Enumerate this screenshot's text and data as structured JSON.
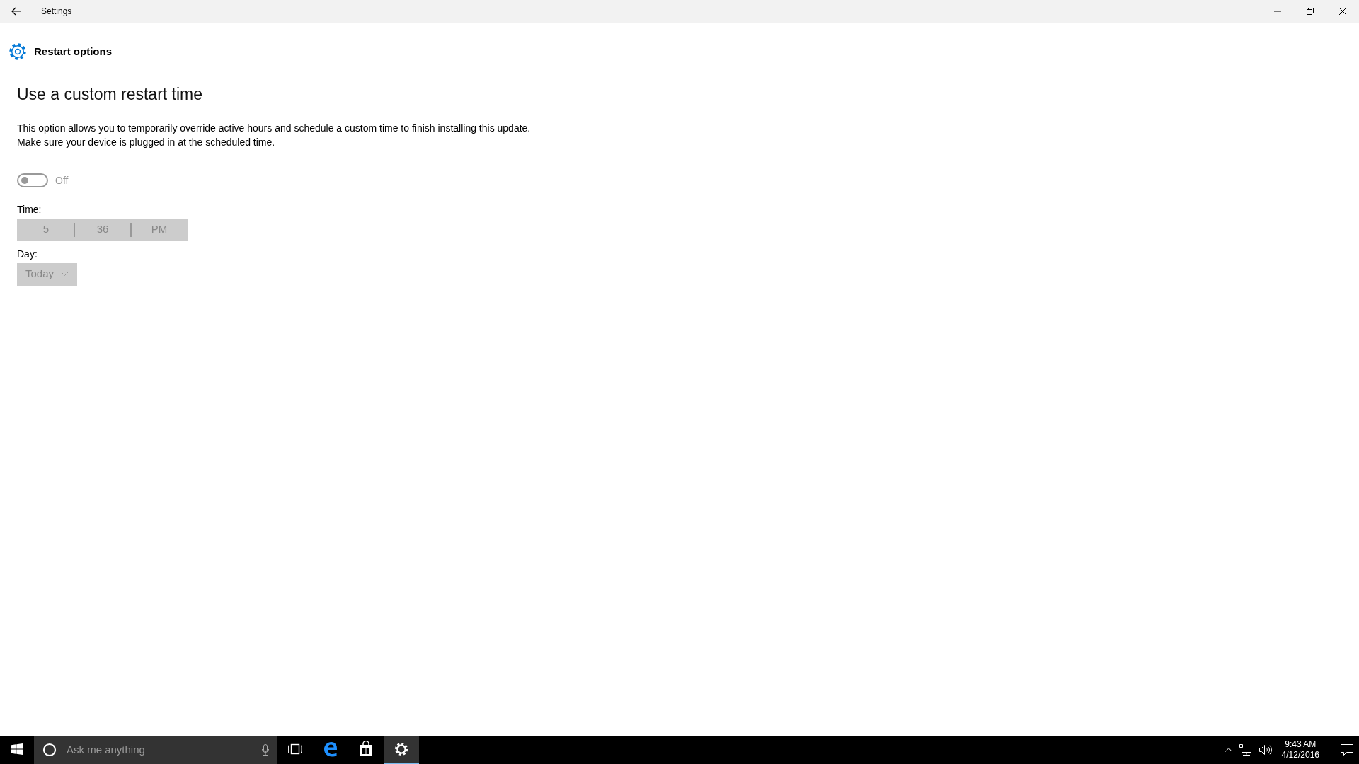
{
  "window": {
    "title": "Settings"
  },
  "page": {
    "title": "Restart options"
  },
  "section": {
    "heading": "Use a custom restart time",
    "description": [
      "This option allows you to temporarily override active hours and schedule a custom time to finish installing this update.",
      "Make sure your device is plugged in at the scheduled time."
    ]
  },
  "toggle": {
    "on": false,
    "label": "Off"
  },
  "time": {
    "label": "Time:",
    "fields": [
      "5",
      "36",
      "PM"
    ],
    "disabled": true
  },
  "day": {
    "label": "Day:",
    "value": "Today",
    "disabled": true
  },
  "taskbar": {
    "search": {
      "placeholder": "Ask me anything"
    },
    "apps": [
      {
        "kind": "task-view",
        "active": false
      },
      {
        "kind": "edge",
        "active": false
      },
      {
        "kind": "store",
        "active": false
      },
      {
        "kind": "settings",
        "active": true
      }
    ],
    "clock": {
      "time": "9:43 AM",
      "date": "4/12/2016"
    }
  }
}
